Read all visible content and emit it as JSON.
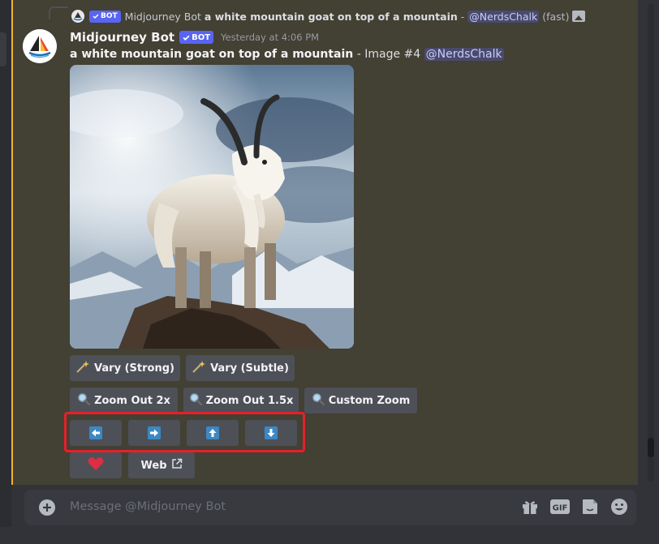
{
  "reply": {
    "bot_name": "Midjourney Bot",
    "bot_tag": "BOT",
    "prompt": "a white mountain goat on top of a mountain",
    "dash": "-",
    "mention": "@NerdsChalk",
    "mode": "(fast)"
  },
  "message": {
    "username": "Midjourney Bot",
    "bot_tag": "BOT",
    "timestamp": "Yesterday at 4:06 PM",
    "prompt": "a white mountain goat on top of a mountain",
    "suffix": " - Image #4 ",
    "mention": "@NerdsChalk"
  },
  "buttons": {
    "vary_strong": "Vary (Strong)",
    "vary_subtle": "Vary (Subtle)",
    "zoom_out_2x": "Zoom Out 2x",
    "zoom_out_1_5x": "Zoom Out 1.5x",
    "custom_zoom": "Custom Zoom",
    "web": "Web"
  },
  "composer": {
    "placeholder": "Message @Midjourney Bot"
  },
  "icons": {
    "arrows": [
      "arrow-left-icon",
      "arrow-right-icon",
      "arrow-up-icon",
      "arrow-down-icon"
    ]
  },
  "colors": {
    "highlight_bg": "#434034",
    "highlight_border": "#f0b232",
    "bot_tag": "#5865f2",
    "button_bg": "#4e5058",
    "arrow_blue": "#3b88c3",
    "annotation_red": "#e5202a"
  }
}
